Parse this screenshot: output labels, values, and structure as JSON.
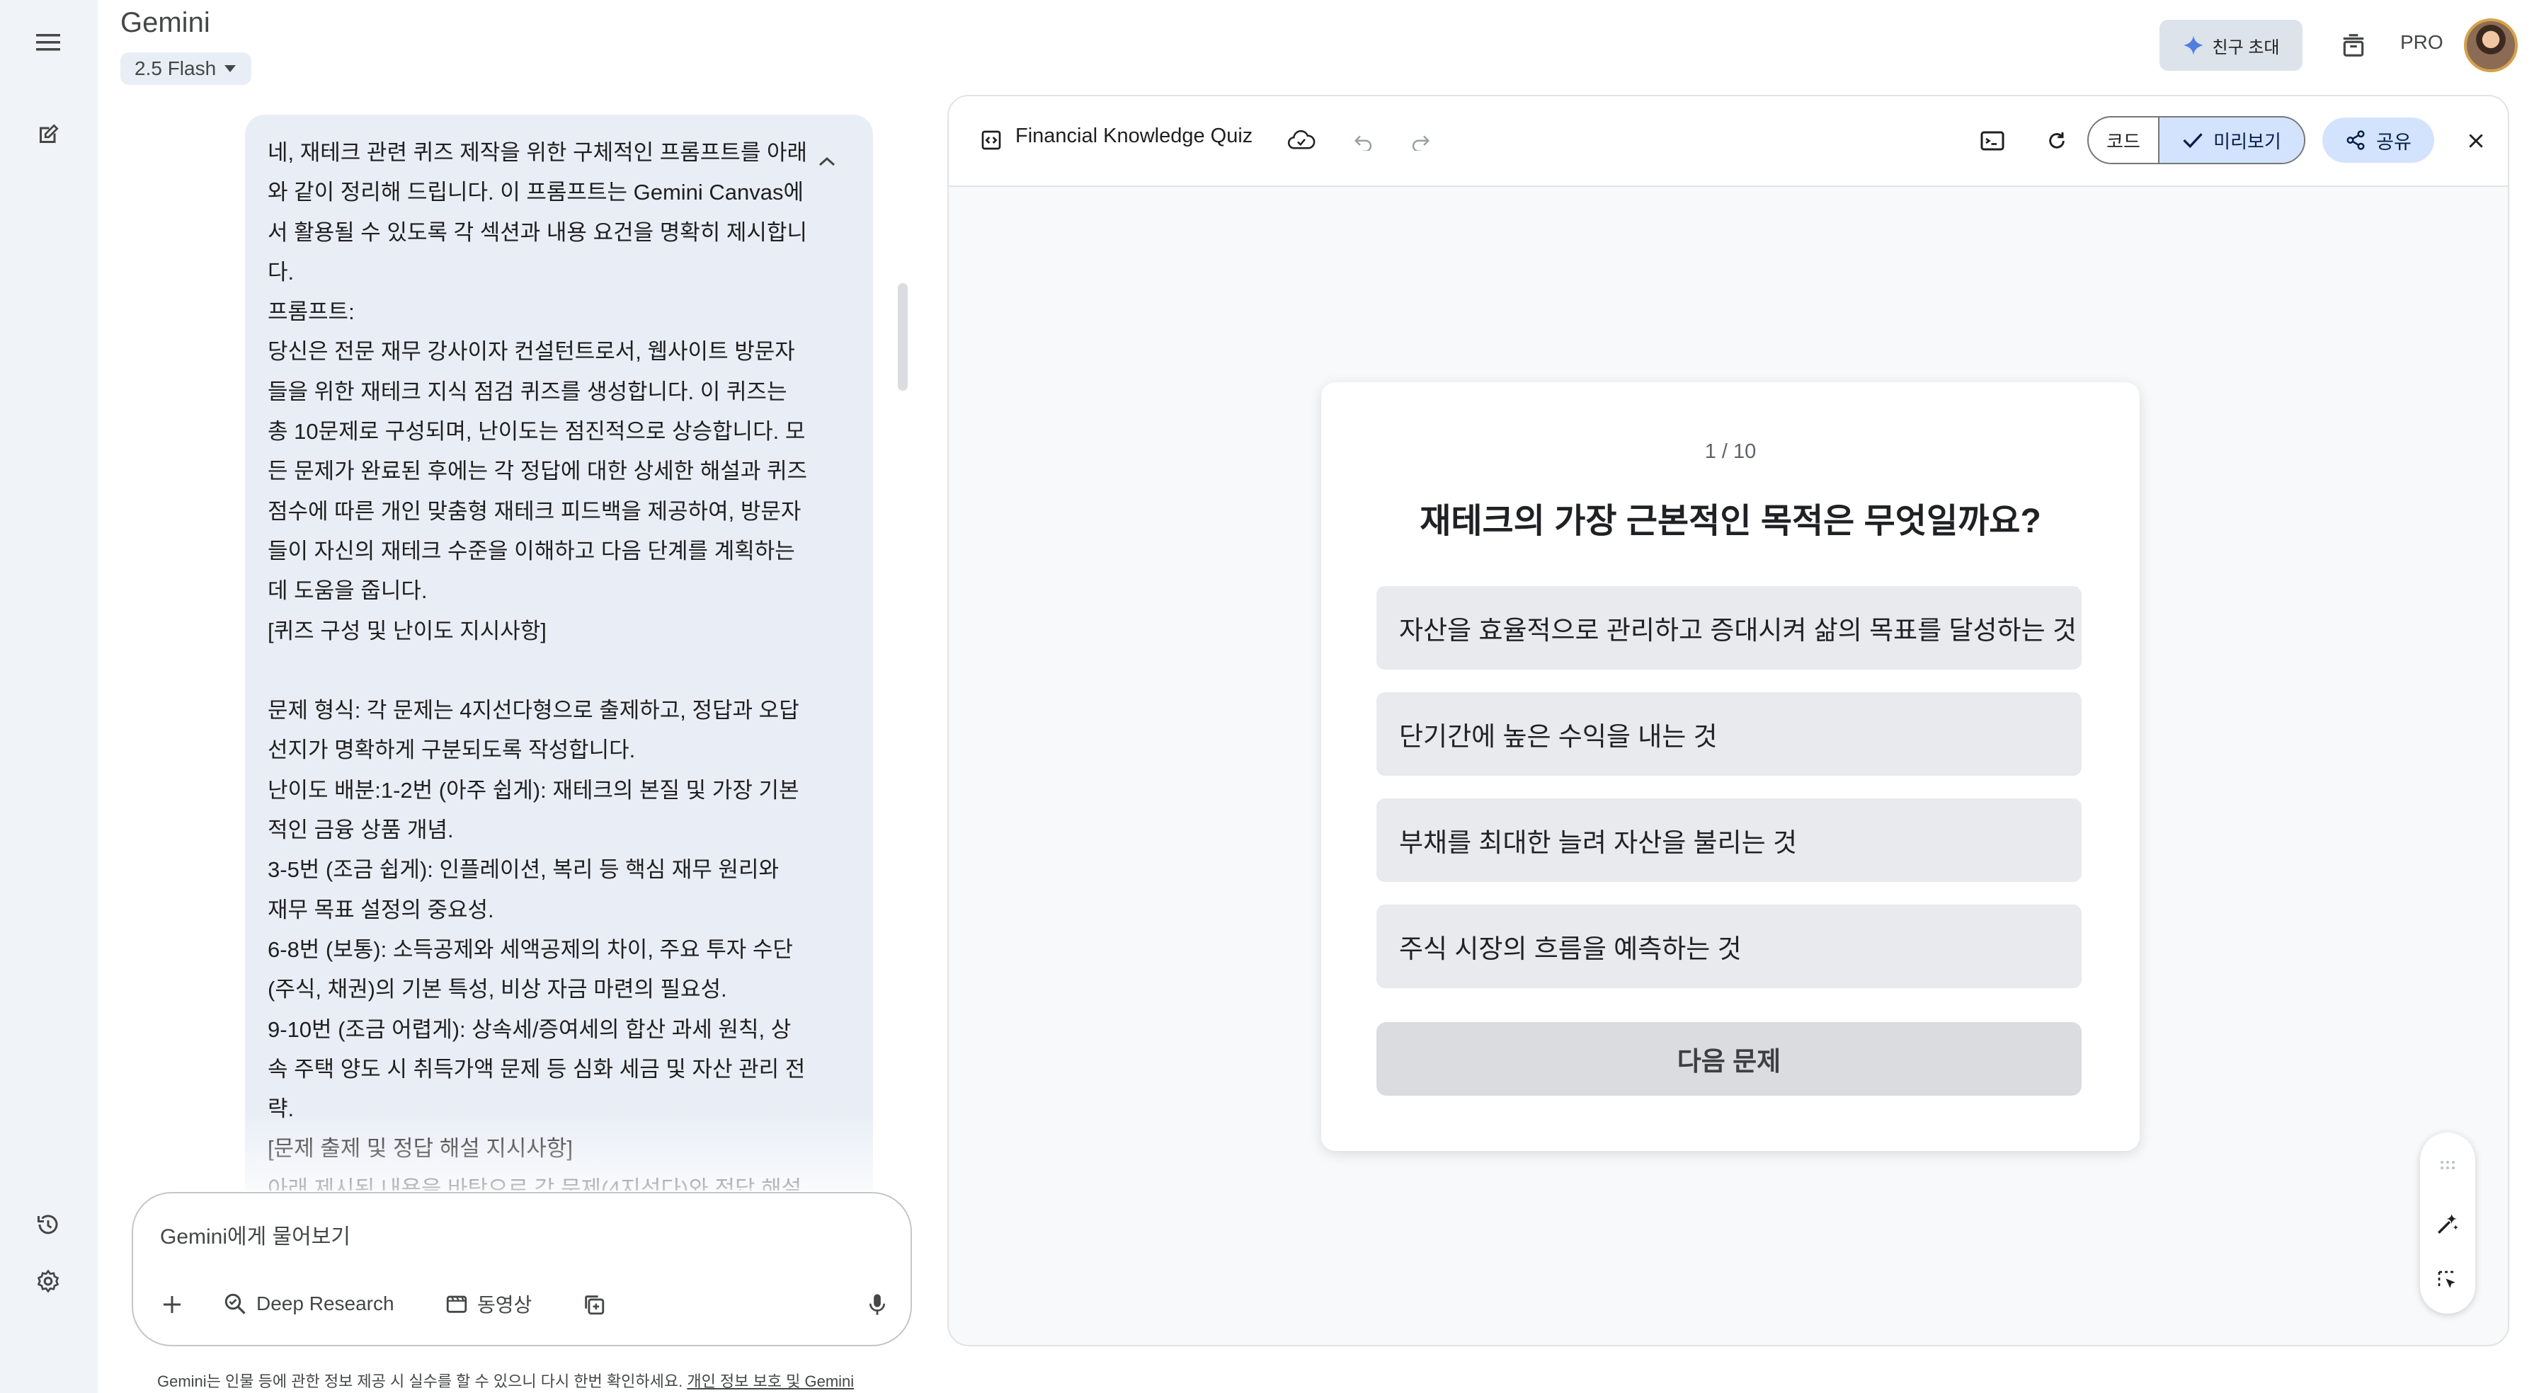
{
  "header": {
    "app_title": "Gemini",
    "model_label": "2.5 Flash",
    "invite_label": "친구 초대",
    "pro_label": "PRO"
  },
  "chat": {
    "message": "네, 재테크 관련 퀴즈 제작을 위한 구체적인 프롬프트를 아래\n와 같이 정리해 드립니다. 이 프롬프트는 Gemini Canvas에\n서 활용될 수 있도록 각 섹션과 내용 요건을 명확히 제시합니\n다.\n프롬프트:\n당신은 전문 재무 강사이자 컨설턴트로서, 웹사이트 방문자\n들을 위한 재테크 지식 점검 퀴즈를 생성합니다. 이 퀴즈는\n총 10문제로 구성되며, 난이도는 점진적으로 상승합니다. 모\n든 문제가 완료된 후에는 각 정답에 대한 상세한 해설과 퀴즈\n점수에 따른 개인 맞춤형 재테크 피드백을 제공하여, 방문자\n들이 자신의 재테크 수준을 이해하고 다음 단계를 계획하는\n데 도움을 줍니다.\n[퀴즈 구성 및 난이도 지시사항]\n\n문제 형식: 각 문제는 4지선다형으로 출제하고, 정답과 오답\n선지가 명확하게 구분되도록 작성합니다.\n난이도 배분:1-2번 (아주 쉽게): 재테크의 본질 및 가장 기본\n적인 금융 상품 개념.\n3-5번 (조금 쉽게): 인플레이션, 복리 등 핵심 재무 원리와\n재무 목표 설정의 중요성.\n6-8번 (보통): 소득공제와 세액공제의 차이, 주요 투자 수단\n(주식, 채권)의 기본 특성, 비상 자금 마련의 필요성.\n9-10번 (조금 어렵게): 상속세/증여세의 합산 과세 원칙, 상\n속 주택 양도 시 취득가액 문제 등 심화 세금 및 자산 관리 전\n략.\n[문제 출제 및 정답 해설 지시사항]\n아래 제시된 내용을 바탕으로 각 문제(4지선다)와 정답 해설",
    "input_placeholder": "Gemini에게 물어보기",
    "tools": {
      "deep_research": "Deep Research",
      "video": "동영상"
    },
    "disclaimer": "Gemini는 인물 등에 관한 정보 제공 시 실수를 할 수 있으니 다시 한번 확인하세요. ",
    "disclaimer_link": "개인 정보 보호 및 Gemini"
  },
  "canvas": {
    "title": "Financial Knowledge Quiz",
    "code_label": "코드",
    "preview_label": "미리보기",
    "share_label": "공유"
  },
  "quiz": {
    "counter": "1 / 10",
    "question": "재테크의 가장 근본적인 목적은 무엇일까요?",
    "options": [
      "자산을 효율적으로 관리하고 증대시켜 삶의 목표를 달성하는 것",
      "단기간에 높은 수익을 내는 것",
      "부채를 최대한 늘려 자산을 불리는 것",
      "주식 시장의 흐름을 예측하는 것"
    ],
    "next_label": "다음 문제"
  },
  "colors": {
    "rail_bg": "#f0f4f9",
    "bubble_bg": "#e9eef6",
    "accent": "#d3e3fd",
    "option_bg": "#e8eaed"
  }
}
